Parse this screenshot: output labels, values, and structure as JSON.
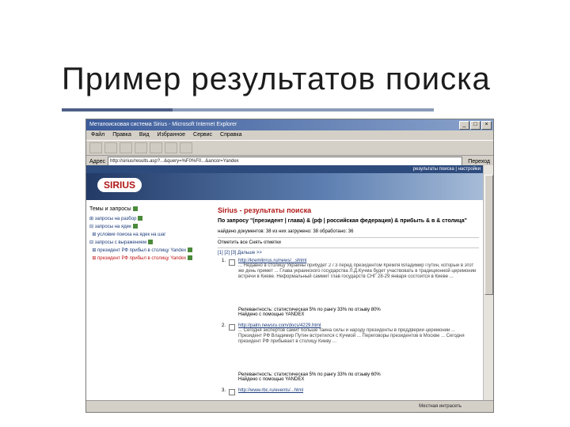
{
  "slide": {
    "title": "Пример результатов поиска"
  },
  "browser": {
    "title": "Метапоисковая система Sirius - Microsoft Internet Explorer",
    "menu": [
      "Файл",
      "Правка",
      "Вид",
      "Избранное",
      "Сервис",
      "Справка"
    ],
    "address_label": "Адрес",
    "address_value": "http://sirius/results.asp?...&query=%F0%F0...&ancor=Yandex",
    "go_label": "Переход",
    "status_text": "Местная интрасеть"
  },
  "site": {
    "topnav": "результаты поиска | настройки",
    "logo": "SIRIUS",
    "sidebar": {
      "header": "Темы и запросы",
      "items": [
        "запросы на разбор",
        "запросы на ядек",
        "условие поиска на ядек на шаг",
        "запросы с выражением",
        "президент РФ прибыл в столицу Yandex",
        "президент РФ прибыл в столицу Yandex"
      ]
    },
    "main": {
      "title": "Sirius - результаты поиска",
      "query": "По запросу \"(президент | глава) & (рф | российская федерация) & прибыть & в & столица\"",
      "count": "найдено документов: 38 из них загружено: 38 обработано: 36",
      "toggle": "Отметить все  Снять отметки",
      "pages": "[1] [2] [3] Дальше >>",
      "results": [
        {
          "n": "1.",
          "url": "http://kremlinrus.ru/news/...shtml",
          "snippet": "... Недавно в столицу Украины прибудет 2 / 3 перед президентом Кремля Владимир Путин, который в этот же день примет ... Глава украинского государства Л.Д.Кучма будет участвовать в традиционной церемонии встречи в Киеве. Неформальный саммит глав государств СНГ 28-29 января состоится в Киеве ...",
          "relevance": "Релевантность: статистическая 5% по рангу 33% по отзыву 80%",
          "found": "Найдено с помощью YANDEX"
        },
        {
          "n": "2.",
          "url": "http://palm.newsru.com/docs/4229.html",
          "snippet": "... Сегодня экспертов самит больше тайна силы и народу президенты в преддверии церемонии ... Президент РФ Владимир Путин встретился с Кучмой ... Переговоры президентов в Москве ... Сегодня президент РФ прибывает в столицу Киеву ...",
          "relevance": "Релевантность: статистическая 5% по рангу 33% по отзыву 60%",
          "found": "Найдено с помощью YANDEX"
        },
        {
          "n": "3.",
          "url": "http://www.rbc.ru/events/...html",
          "snippet": "",
          "relevance": "",
          "found": ""
        }
      ]
    }
  }
}
